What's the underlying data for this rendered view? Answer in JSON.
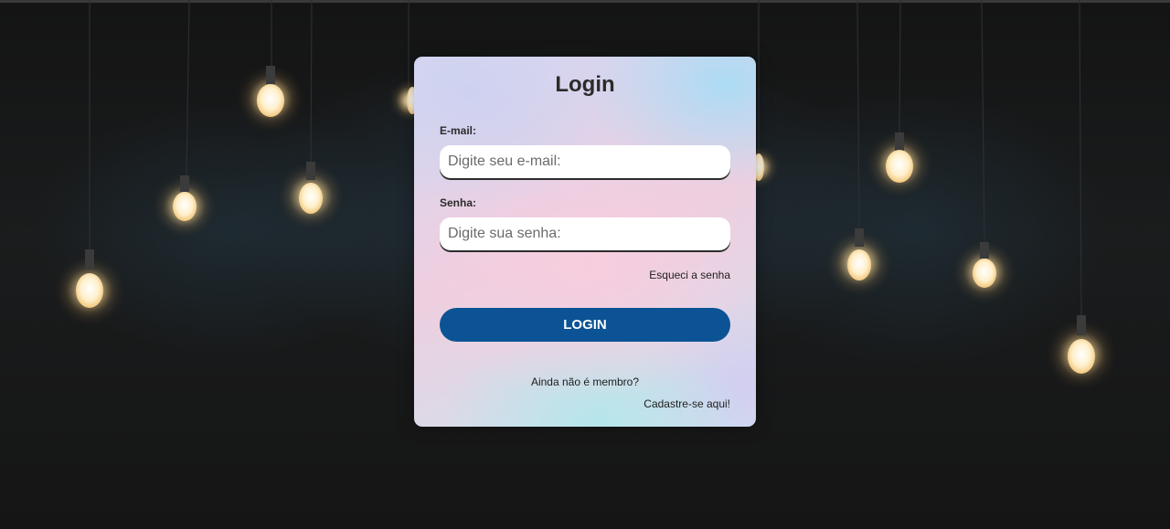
{
  "background": {
    "description_icon": "hanging-light-bulbs",
    "bulb_color": "#fff3d6",
    "glow_color": "#ffd88a"
  },
  "login_card": {
    "title": "Login",
    "email": {
      "label": "E-mail:",
      "placeholder": "Digite seu e-mail:",
      "value": ""
    },
    "password": {
      "label": "Senha:",
      "placeholder": "Digite sua senha:",
      "value": ""
    },
    "forgot_link": "Esqueci a senha",
    "submit_label": "LOGIN",
    "not_member_text": "Ainda não é membro?",
    "signup_link": "Cadastre-se aqui!",
    "colors": {
      "button": "#0b5394",
      "button_text": "#ffffff",
      "text": "#2b2b2b"
    }
  }
}
